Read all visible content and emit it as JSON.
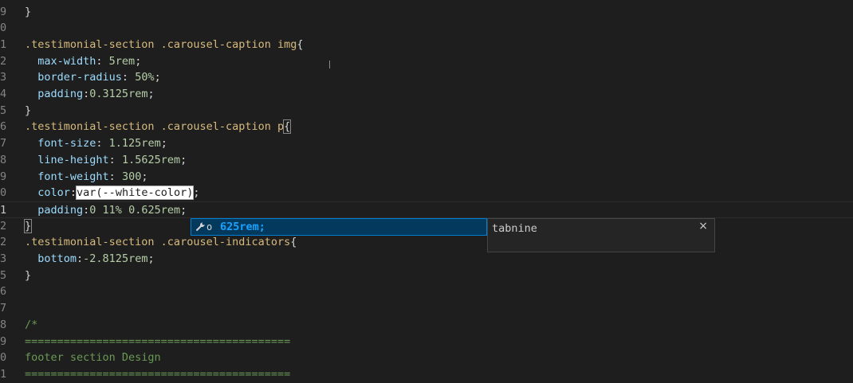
{
  "editor": {
    "lines": [
      {
        "gutter": "9",
        "segments": [
          {
            "t": "}",
            "c": "punc"
          }
        ]
      },
      {
        "gutter": "0",
        "segments": []
      },
      {
        "gutter": "1",
        "segments": [
          {
            "t": ".testimonial-section .carousel-caption img",
            "c": "sel"
          },
          {
            "t": "{",
            "c": "punc"
          }
        ]
      },
      {
        "gutter": "2",
        "segments": [
          {
            "t": "  max-width",
            "c": "prop"
          },
          {
            "t": ": ",
            "c": "punc"
          },
          {
            "t": "5rem",
            "c": "num"
          },
          {
            "t": ";",
            "c": "punc"
          }
        ]
      },
      {
        "gutter": "3",
        "segments": [
          {
            "t": "  border-radius",
            "c": "prop"
          },
          {
            "t": ": ",
            "c": "punc"
          },
          {
            "t": "50%",
            "c": "num"
          },
          {
            "t": ";",
            "c": "punc"
          }
        ]
      },
      {
        "gutter": "4",
        "segments": [
          {
            "t": "  padding",
            "c": "prop"
          },
          {
            "t": ":",
            "c": "punc"
          },
          {
            "t": "0.3125rem",
            "c": "num"
          },
          {
            "t": ";",
            "c": "punc"
          }
        ]
      },
      {
        "gutter": "5",
        "segments": [
          {
            "t": "}",
            "c": "punc"
          }
        ]
      },
      {
        "gutter": "6",
        "segments": [
          {
            "t": ".testimonial-section .carousel-caption p",
            "c": "sel"
          },
          {
            "t": "{",
            "c": "punc bracket-match"
          }
        ]
      },
      {
        "gutter": "7",
        "segments": [
          {
            "t": "  font-size",
            "c": "prop"
          },
          {
            "t": ": ",
            "c": "punc"
          },
          {
            "t": "1.125rem",
            "c": "num"
          },
          {
            "t": ";",
            "c": "punc"
          }
        ]
      },
      {
        "gutter": "8",
        "segments": [
          {
            "t": "  line-height",
            "c": "prop"
          },
          {
            "t": ": ",
            "c": "punc"
          },
          {
            "t": "1.5625rem",
            "c": "num"
          },
          {
            "t": ";",
            "c": "punc"
          }
        ]
      },
      {
        "gutter": "9",
        "segments": [
          {
            "t": "  font-weight",
            "c": "prop"
          },
          {
            "t": ": ",
            "c": "punc"
          },
          {
            "t": "300",
            "c": "num"
          },
          {
            "t": ";",
            "c": "punc"
          }
        ]
      },
      {
        "gutter": "0",
        "segments": [
          {
            "t": "  color",
            "c": "prop"
          },
          {
            "t": ":",
            "c": "punc"
          },
          {
            "t": "var(--white-color)",
            "c": "hlbox"
          },
          {
            "t": ";",
            "c": "punc"
          }
        ]
      },
      {
        "gutter": "1",
        "active": true,
        "segments": [
          {
            "t": "  padding",
            "c": "prop"
          },
          {
            "t": ":",
            "c": "punc"
          },
          {
            "t": "0 11% 0.625rem",
            "c": "num"
          },
          {
            "t": ";",
            "c": "punc"
          }
        ]
      },
      {
        "gutter": "2",
        "segments": [
          {
            "t": "}",
            "c": "punc bracket-match"
          }
        ]
      },
      {
        "gutter": "2",
        "segments": [
          {
            "t": ".testimonial-section .carousel-indicators",
            "c": "sel"
          },
          {
            "t": "{",
            "c": "punc"
          }
        ]
      },
      {
        "gutter": "3",
        "segments": [
          {
            "t": "  bottom",
            "c": "prop"
          },
          {
            "t": ":",
            "c": "punc"
          },
          {
            "t": "-2.8125rem",
            "c": "num"
          },
          {
            "t": ";",
            "c": "punc"
          }
        ]
      },
      {
        "gutter": "5",
        "segments": [
          {
            "t": "}",
            "c": "punc"
          }
        ]
      },
      {
        "gutter": "6",
        "segments": []
      },
      {
        "gutter": "7",
        "segments": []
      },
      {
        "gutter": "8",
        "segments": [
          {
            "t": "/*",
            "c": "cmt"
          }
        ]
      },
      {
        "gutter": "9",
        "segments": [
          {
            "t": "=========================================",
            "c": "cmt"
          }
        ]
      },
      {
        "gutter": "0",
        "segments": [
          {
            "t": "footer section Design",
            "c": "cmt"
          }
        ]
      },
      {
        "gutter": "1",
        "segments": [
          {
            "t": "=========================================",
            "c": "cmt"
          }
        ]
      }
    ]
  },
  "suggest": {
    "icon": "wrench-icon",
    "kind": "o",
    "label": "625rem;"
  },
  "details": {
    "title": "tabnine",
    "close": "×"
  },
  "colors": {
    "background": "#1e1e1e",
    "selector": "#d7ba7d",
    "property": "#9cdcfe",
    "number": "#b5cea8",
    "comment": "#6a9955",
    "suggest_highlight": "#04395e",
    "suggest_label": "#18a3ff"
  }
}
